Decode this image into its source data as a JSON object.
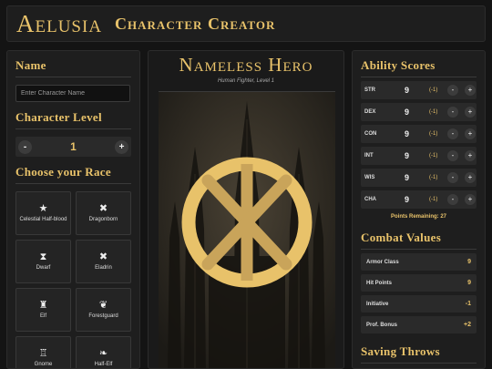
{
  "header": {
    "logo": "Aelusia",
    "title": "Character Creator"
  },
  "left": {
    "name_title": "Name",
    "name_placeholder": "Enter Character Name",
    "level_title": "Character Level",
    "level_value": "1",
    "minus": "-",
    "plus": "+",
    "race_title": "Choose your Race",
    "races": [
      {
        "name": "Celestial Half-blood",
        "icon": "star-icon",
        "glyph": "★"
      },
      {
        "name": "Dragonborn",
        "icon": "cross-icon",
        "glyph": "✖"
      },
      {
        "name": "Dwarf",
        "icon": "hourglass-icon",
        "glyph": "⧗"
      },
      {
        "name": "Eladrin",
        "icon": "cross-icon",
        "glyph": "✖"
      },
      {
        "name": "Elf",
        "icon": "elf-icon",
        "glyph": "♜"
      },
      {
        "name": "Forestguard",
        "icon": "leaf-icon",
        "glyph": "❦"
      },
      {
        "name": "Gnome",
        "icon": "tower-icon",
        "glyph": "♖"
      },
      {
        "name": "Half-Elf",
        "icon": "leaf-icon",
        "glyph": "❧"
      }
    ]
  },
  "center": {
    "hero_name": "Nameless Hero",
    "subtitle": "Human Fighter, Level 1",
    "emblem_icon": "emblem-icon"
  },
  "right": {
    "ability_title": "Ability Scores",
    "abilities": [
      {
        "abbr": "STR",
        "value": "9",
        "mod": "(-1)"
      },
      {
        "abbr": "DEX",
        "value": "9",
        "mod": "(-1)"
      },
      {
        "abbr": "CON",
        "value": "9",
        "mod": "(-1)"
      },
      {
        "abbr": "INT",
        "value": "9",
        "mod": "(-1)"
      },
      {
        "abbr": "WIS",
        "value": "9",
        "mod": "(-1)"
      },
      {
        "abbr": "CHA",
        "value": "9",
        "mod": "(-1)"
      }
    ],
    "points_remaining": "Points Remaining: 27",
    "combat_title": "Combat Values",
    "combat": [
      {
        "label": "Armor Class",
        "value": "9"
      },
      {
        "label": "Hit Points",
        "value": "9"
      },
      {
        "label": "Initiative",
        "value": "-1"
      },
      {
        "label": "Prof. Bonus",
        "value": "+2"
      }
    ],
    "saving_title": "Saving Throws"
  },
  "colors": {
    "accent": "#e8c26a",
    "panel": "#1e1e1e",
    "background": "#141414"
  }
}
